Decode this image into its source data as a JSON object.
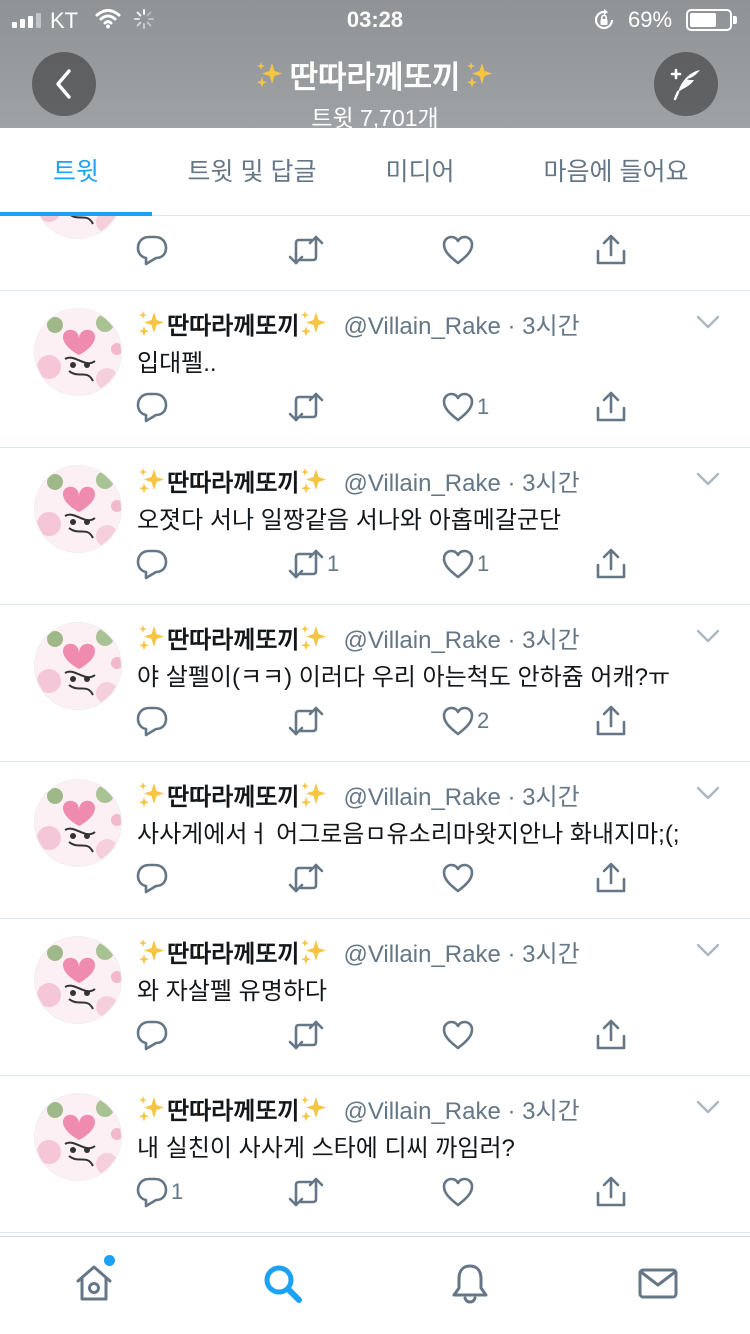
{
  "status_bar": {
    "carrier": "KT",
    "time": "03:28",
    "battery_pct": "69%",
    "battery_level": 0.69,
    "icons": [
      "signal-icon",
      "wifi-icon",
      "activity-spinner-icon",
      "rotation-lock-icon",
      "battery-icon"
    ]
  },
  "header": {
    "title": "딴따라께또끼",
    "subtitle": "트윗 7,701개",
    "back_icon": "chevron-left-icon",
    "compose_icon": "compose-feather-icon",
    "title_emoji": "sparkles"
  },
  "tabs": [
    {
      "label": "트윗",
      "active": true
    },
    {
      "label": "트윗 및 답글",
      "active": false
    },
    {
      "label": "미디어",
      "active": false
    },
    {
      "label": "마음에 들어요",
      "active": false
    }
  ],
  "tweets": [
    {
      "display_name": "",
      "handle": "",
      "time": "",
      "text": "",
      "reply_count": "",
      "retweet_count": "",
      "like_count": ""
    },
    {
      "display_name": "딴따라께또끼",
      "handle": "@Villain_Rake",
      "time": "3시간",
      "text": "입대펠..",
      "reply_count": "",
      "retweet_count": "",
      "like_count": "1"
    },
    {
      "display_name": "딴따라께또끼",
      "handle": "@Villain_Rake",
      "time": "3시간",
      "text": "오졋다 서나 일짱같음 서나와 아홉메갈군단",
      "reply_count": "",
      "retweet_count": "1",
      "like_count": "1"
    },
    {
      "display_name": "딴따라께또끼",
      "handle": "@Villain_Rake",
      "time": "3시간",
      "text": "야 살펠이(ㅋㅋ) 이러다 우리 아는척도 안하쥼 어캐?ㅠ",
      "reply_count": "",
      "retweet_count": "",
      "like_count": "2"
    },
    {
      "display_name": "딴따라께또끼",
      "handle": "@Villain_Rake",
      "time": "3시간",
      "text": "사사게에서ㅓ 어그로음ㅁ유소리마왓지안나 화내지마;(;",
      "reply_count": "",
      "retweet_count": "",
      "like_count": ""
    },
    {
      "display_name": "딴따라께또끼",
      "handle": "@Villain_Rake",
      "time": "3시간",
      "text": "와 자살펠 유명하다",
      "reply_count": "",
      "retweet_count": "",
      "like_count": ""
    },
    {
      "display_name": "딴따라께또끼",
      "handle": "@Villain_Rake",
      "time": "3시간",
      "text": "내 실친이 사사게 스타에 디씨 까임러?",
      "reply_count": "1",
      "retweet_count": "",
      "like_count": ""
    }
  ],
  "bottom_nav": [
    {
      "name": "home",
      "icon": "home-icon",
      "active": false,
      "has_notification_dot": true
    },
    {
      "name": "search",
      "icon": "search-icon",
      "active": true
    },
    {
      "name": "notifications",
      "icon": "bell-icon",
      "active": false
    },
    {
      "name": "messages",
      "icon": "mail-icon",
      "active": false
    }
  ],
  "colors": {
    "accent": "#1da1f2",
    "icon_gray": "#657786",
    "header_bg": "#979b9e",
    "divider": "#e1e8ed"
  }
}
